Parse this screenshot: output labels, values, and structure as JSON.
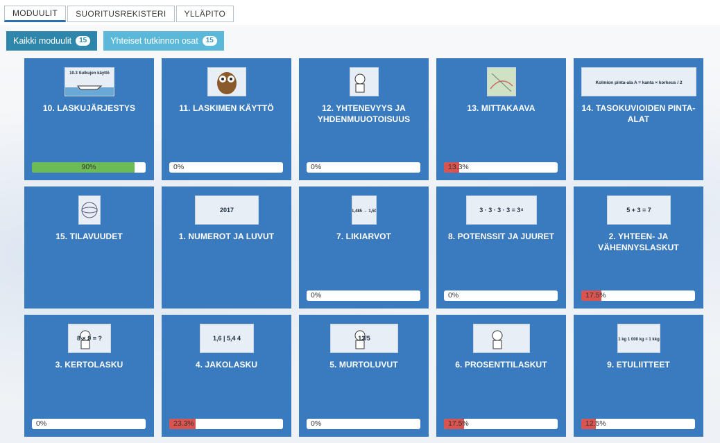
{
  "tabs": [
    {
      "label": "MODUULIT",
      "active": true
    },
    {
      "label": "SUORITUSREKISTERI",
      "active": false
    },
    {
      "label": "YLLÄPITO",
      "active": false
    }
  ],
  "filters": [
    {
      "label": "Kaikki moduulit",
      "count": "15"
    },
    {
      "label": "Yhteiset tutkinnon osat",
      "count": "15"
    }
  ],
  "colors": {
    "card": "#3a7bbf",
    "progress_green": "#6cbb55",
    "progress_red": "#d9534f",
    "filter_primary": "#2e86ab",
    "filter_secondary": "#5ab8d8"
  },
  "modules": [
    {
      "title": "10. LASKUJÄRJESTYS",
      "thumb_text": "10.3 Sulkujen käyttö",
      "thumb_icon": "boat-image",
      "progress": 90,
      "progress_label": "90%"
    },
    {
      "title": "11. LASKIMEN KÄYTTÖ",
      "thumb_text": "",
      "thumb_icon": "owl-image",
      "progress": 0,
      "progress_label": "0%"
    },
    {
      "title": "12. YHTENEVYYS JA YHDENMUUOTOISUUS",
      "thumb_text": "",
      "thumb_icon": "character-image",
      "progress": 0,
      "progress_label": "0%"
    },
    {
      "title": "13. MITTAKAAVA",
      "thumb_text": "",
      "thumb_icon": "map-image",
      "progress": 13.3,
      "progress_label": "13.3%"
    },
    {
      "title": "14. TASOKUVIOIDEN PINTA-ALAT",
      "thumb_text": "Kolmion pinta-ala A = kanta × korkeus / 2",
      "thumb_icon": "formula-image",
      "progress": null,
      "progress_label": ""
    },
    {
      "title": "15. TILAVUUDET",
      "thumb_text": "",
      "thumb_icon": "sphere-image",
      "progress": null,
      "progress_label": ""
    },
    {
      "title": "1. NUMEROT JA LUVUT",
      "thumb_text": "2017",
      "thumb_icon": "numbers-image",
      "progress": null,
      "progress_label": ""
    },
    {
      "title": "7. LIKIARVOT",
      "thumb_text": "1,485 → 1,50",
      "thumb_icon": "rounding-image",
      "progress": 0,
      "progress_label": "0%"
    },
    {
      "title": "8. POTENSSIT JA JUURET",
      "thumb_text": "3 · 3 · 3 · 3 = 3⁴",
      "thumb_icon": "power-image",
      "progress": 0,
      "progress_label": "0%"
    },
    {
      "title": "2. YHTEEN- JA VÄHENNYSLASKUT",
      "thumb_text": "5 + 3 = 7",
      "thumb_icon": "sum-image",
      "progress": 17.5,
      "progress_label": "17.5%"
    },
    {
      "title": "3. KERTOLASKU",
      "thumb_text": "8 × 9 = ?",
      "thumb_icon": "thinking-person-image",
      "progress": 0,
      "progress_label": "0%"
    },
    {
      "title": "4. JAKOLASKU",
      "thumb_text": "1,6 | 5,4 4",
      "thumb_icon": "division-image",
      "progress": 23.3,
      "progress_label": "23.3%"
    },
    {
      "title": "5. MURTOLUVUT",
      "thumb_text": "13/5",
      "thumb_icon": "fraction-image",
      "progress": 0,
      "progress_label": "0%"
    },
    {
      "title": "6. PROSENTTILASKUT",
      "thumb_text": "",
      "thumb_icon": "percent-image",
      "progress": 17.5,
      "progress_label": "17.5%"
    },
    {
      "title": "9. ETULIITTEET",
      "thumb_text": "1 kg  1 000 kg = 1 kkg",
      "thumb_icon": "prefix-image",
      "progress": 12.5,
      "progress_label": "12.5%"
    }
  ]
}
